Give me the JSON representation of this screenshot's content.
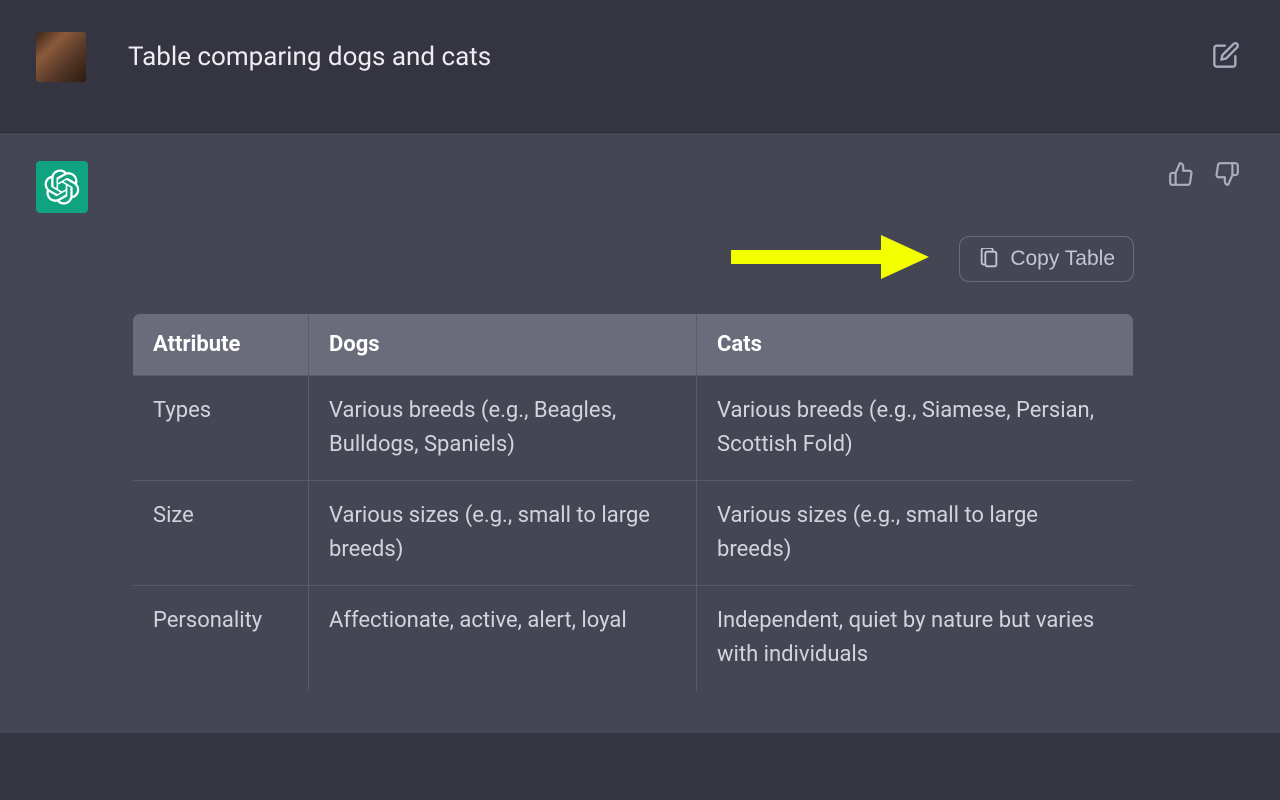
{
  "user": {
    "prompt": "Table comparing dogs and cats"
  },
  "actions": {
    "copyTableLabel": "Copy Table"
  },
  "table": {
    "headers": [
      "Attribute",
      "Dogs",
      "Cats"
    ],
    "rows": [
      {
        "attribute": "Types",
        "dogs": "Various breeds (e.g., Beagles, Bulldogs, Spaniels)",
        "cats": "Various breeds (e.g., Siamese, Persian, Scottish Fold)"
      },
      {
        "attribute": "Size",
        "dogs": "Various sizes (e.g., small to large breeds)",
        "cats": "Various sizes (e.g., small to large breeds)"
      },
      {
        "attribute": "Personality",
        "dogs": "Affectionate, active, alert, loyal",
        "cats": "Independent, quiet by nature but varies with individuals"
      }
    ]
  }
}
